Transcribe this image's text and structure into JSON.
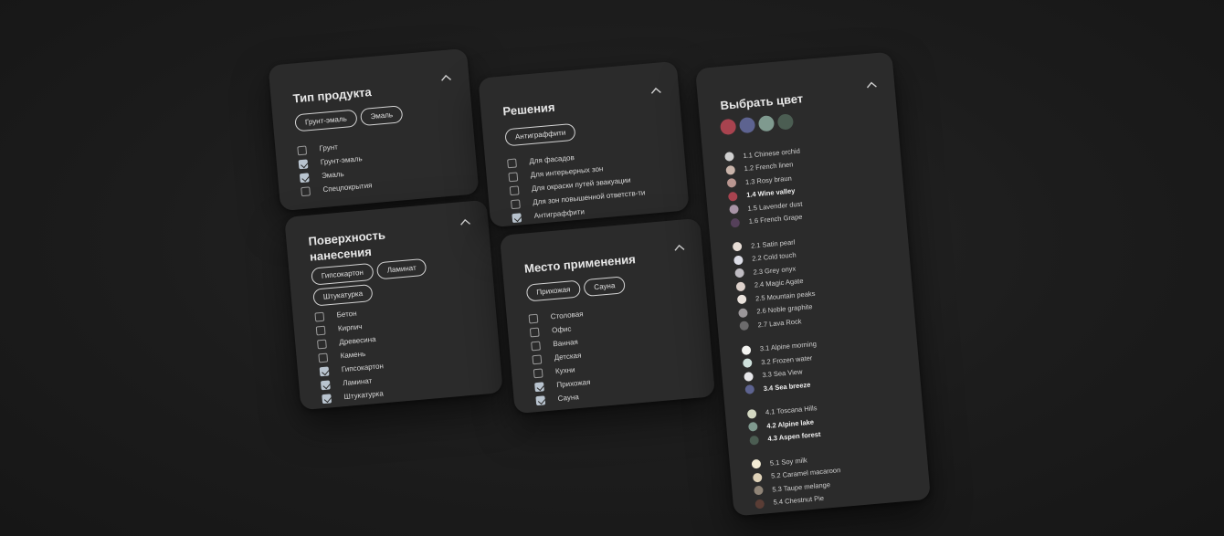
{
  "colors": {
    "card_bg": "#2b2b2b",
    "text": "#e8e8e8",
    "checkbox_checked": "#b9c4cf"
  },
  "product_type": {
    "title": "Тип продукта",
    "chips": [
      "Грунт-эмаль",
      "Эмаль"
    ],
    "options": [
      {
        "label": "Грунт",
        "checked": false
      },
      {
        "label": "Грунт-эмаль",
        "checked": true
      },
      {
        "label": "Эмаль",
        "checked": true
      },
      {
        "label": "Спецпокрытия",
        "checked": false
      }
    ]
  },
  "surface": {
    "title": "Поверхность нанесения",
    "chips": [
      "Гипсокартон",
      "Ламинат",
      "Штукатурка"
    ],
    "options": [
      {
        "label": "Бетон",
        "checked": false
      },
      {
        "label": "Кирпич",
        "checked": false
      },
      {
        "label": "Древесина",
        "checked": false
      },
      {
        "label": "Камень",
        "checked": false
      },
      {
        "label": "Гипсокартон",
        "checked": true
      },
      {
        "label": "Ламинат",
        "checked": true
      },
      {
        "label": "Штукатурка",
        "checked": true
      }
    ]
  },
  "solutions": {
    "title": "Решения",
    "chips": [
      "Антиграффити"
    ],
    "options": [
      {
        "label": "Для фасадов",
        "checked": false
      },
      {
        "label": "Для интерьерных зон",
        "checked": false
      },
      {
        "label": "Для окраски путей эвакуации",
        "checked": false
      },
      {
        "label": "Для зон повышенной ответств-ти",
        "checked": false
      },
      {
        "label": "Антиграффити",
        "checked": true
      }
    ]
  },
  "place": {
    "title": "Место применения",
    "chips": [
      "Прихожая",
      "Сауна"
    ],
    "options": [
      {
        "label": "Столовая",
        "checked": false
      },
      {
        "label": "Офис",
        "checked": false
      },
      {
        "label": "Ванная",
        "checked": false
      },
      {
        "label": "Детская",
        "checked": false
      },
      {
        "label": "Кухни",
        "checked": false
      },
      {
        "label": "Прихожая",
        "checked": true
      },
      {
        "label": "Сауна",
        "checked": true
      }
    ]
  },
  "color_picker": {
    "title": "Выбрать цвет",
    "selected_swatches": [
      "#a8434f",
      "#5d6390",
      "#7f9a8f",
      "#4b5d52"
    ],
    "groups": [
      [
        {
          "label": "1.1 Chinese orchid",
          "color": "#cfcfcf",
          "bold": false
        },
        {
          "label": "1.2 French linen",
          "color": "#c9b4aa",
          "bold": false
        },
        {
          "label": "1.3 Rosy braun",
          "color": "#b99690",
          "bold": false
        },
        {
          "label": "1.4 Wine valley",
          "color": "#a8434f",
          "bold": true
        },
        {
          "label": "1.5 Lavender dust",
          "color": "#a894a6",
          "bold": false
        },
        {
          "label": "1.6 French Grape",
          "color": "#55405a",
          "bold": false
        }
      ],
      [
        {
          "label": "2.1 Satin pearl",
          "color": "#e7ddd6",
          "bold": false
        },
        {
          "label": "2.2 Cold touch",
          "color": "#dcdde6",
          "bold": false
        },
        {
          "label": "2.3 Grey onyx",
          "color": "#bfbcc2",
          "bold": false
        },
        {
          "label": "2.4 Magic Agate",
          "color": "#ddd1cb",
          "bold": false
        },
        {
          "label": "2.5 Mountain peaks",
          "color": "#eae2dc",
          "bold": false
        },
        {
          "label": "2.6 Noble  graphite",
          "color": "#9a9699",
          "bold": false
        },
        {
          "label": "2.7 Lava Rock",
          "color": "#6c6b6c",
          "bold": false
        }
      ],
      [
        {
          "label": "3.1 Alpine morning",
          "color": "#f4f4f1",
          "bold": false
        },
        {
          "label": "3.2 Frozen water",
          "color": "#cfe1dc",
          "bold": false
        },
        {
          "label": "3.3 Sea View",
          "color": "#e6e6e9",
          "bold": false
        },
        {
          "label": "3.4 Sea breeze",
          "color": "#5d6390",
          "bold": true
        }
      ],
      [
        {
          "label": "4.1 Toscana  Hills",
          "color": "#d3d8c2",
          "bold": false
        },
        {
          "label": "4.2 Alpine lake",
          "color": "#7f9a8f",
          "bold": true
        },
        {
          "label": "4.3 Aspen  forest",
          "color": "#4b5d52",
          "bold": true
        }
      ],
      [
        {
          "label": "5.1 Soy milk",
          "color": "#f3ecd5",
          "bold": false
        },
        {
          "label": "5.2 Caramel macaroon",
          "color": "#dfd2b8",
          "bold": false
        },
        {
          "label": "5.3 Taupe melange",
          "color": "#8f8477",
          "bold": false
        },
        {
          "label": "5.4 Chestnut Pie",
          "color": "#5a3d35",
          "bold": false
        }
      ]
    ]
  }
}
